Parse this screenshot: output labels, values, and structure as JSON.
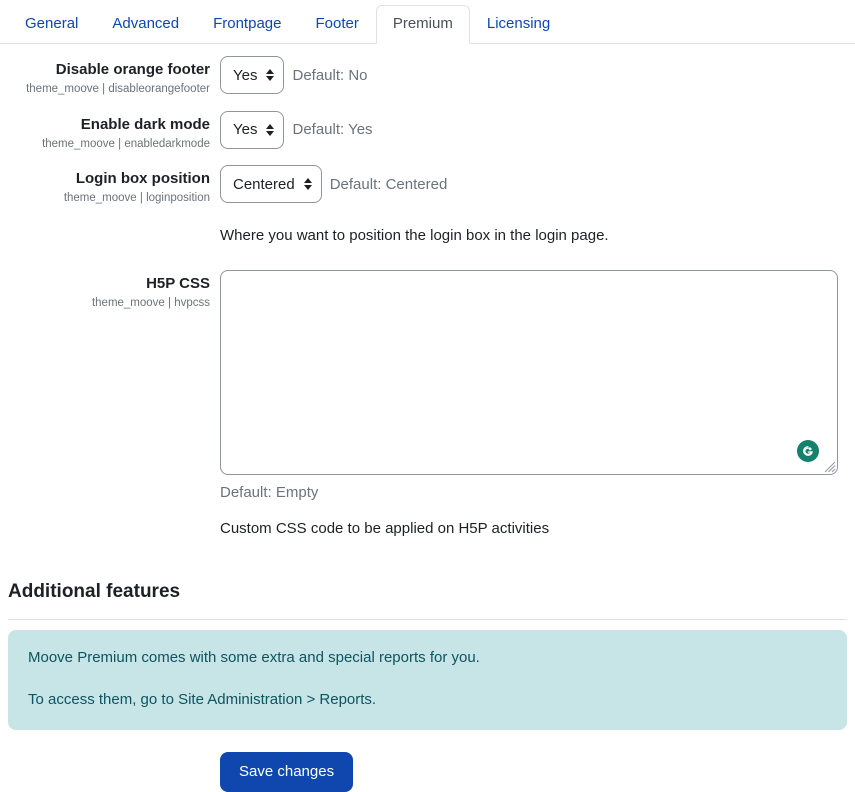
{
  "tabs": [
    {
      "label": "General",
      "active": false
    },
    {
      "label": "Advanced",
      "active": false
    },
    {
      "label": "Frontpage",
      "active": false
    },
    {
      "label": "Footer",
      "active": false
    },
    {
      "label": "Premium",
      "active": true
    },
    {
      "label": "Licensing",
      "active": false
    }
  ],
  "settings": [
    {
      "label": "Disable orange footer",
      "key": "theme_moove | disableorangefooter",
      "control": "select",
      "value": "Yes",
      "default_note": "Default: No",
      "help": ""
    },
    {
      "label": "Enable dark mode",
      "key": "theme_moove | enabledarkmode",
      "control": "select",
      "value": "Yes",
      "default_note": "Default: Yes",
      "help": ""
    },
    {
      "label": "Login box position",
      "key": "theme_moove | loginposition",
      "control": "select",
      "value": "Centered",
      "default_note": "Default: Centered",
      "help": "Where you want to position the login box in the login page."
    }
  ],
  "textarea_setting": {
    "label": "H5P CSS",
    "key": "theme_moove | hvpcss",
    "value": "",
    "placeholder": "",
    "default_note": "Default: Empty",
    "help": "Custom CSS code to be applied on H5P activities",
    "assistant_icon": "grammarly-icon",
    "resize_handle_icon": "resize-handle-icon"
  },
  "additional_features": {
    "heading": "Additional features",
    "alert_lines": [
      "Moove Premium comes with some extra and special reports for you.",
      "To access them, go to Site Administration > Reports."
    ]
  },
  "actions": {
    "save_label": "Save changes"
  },
  "colors": {
    "link": "#0f47af",
    "primary_button": "#0f47af",
    "alert_bg": "#c7e5e7",
    "alert_text": "#0c5460",
    "grammarly_green": "#15806c",
    "border": "#dee2e6",
    "muted_text": "#6a737b"
  }
}
